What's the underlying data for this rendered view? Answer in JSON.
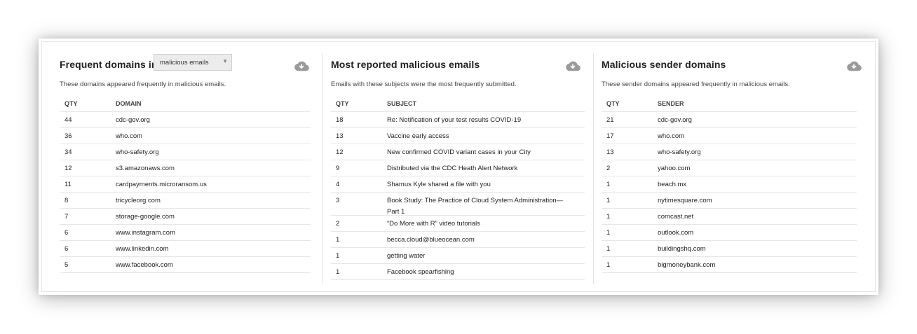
{
  "panels": [
    {
      "title": "Frequent domains in",
      "selector": {
        "value": "malicious emails"
      },
      "description": "These domains appeared frequently in malicious emails.",
      "icon": "cloud-download-icon",
      "columns": {
        "qty": "QTY",
        "value": "DOMAIN"
      },
      "rows": [
        {
          "qty": "44",
          "value": "cdc-gov.org"
        },
        {
          "qty": "36",
          "value": "who.com"
        },
        {
          "qty": "34",
          "value": "who-safety.org"
        },
        {
          "qty": "12",
          "value": "s3.amazonaws.com"
        },
        {
          "qty": "11",
          "value": "cardpayments.microransom.us"
        },
        {
          "qty": "8",
          "value": "tricycleorg.com"
        },
        {
          "qty": "7",
          "value": "storage-google.com"
        },
        {
          "qty": "6",
          "value": "www.instagram.com"
        },
        {
          "qty": "6",
          "value": "www.linkedin.com"
        },
        {
          "qty": "5",
          "value": "www.facebook.com"
        }
      ]
    },
    {
      "title": "Most reported malicious emails",
      "description": "Emails with these subjects were the most frequently submitted.",
      "icon": "cloud-download-icon",
      "columns": {
        "qty": "QTY",
        "value": "SUBJECT"
      },
      "rows": [
        {
          "qty": "18",
          "value": "Re: Notification of your test results COVID-19"
        },
        {
          "qty": "13",
          "value": "Vaccine early access"
        },
        {
          "qty": "12",
          "value": "New confirmed COVID variant cases in your City"
        },
        {
          "qty": "9",
          "value": "Distributed via the CDC Heath Alert Network"
        },
        {
          "qty": "4",
          "value": "Shamus Kyle shared a file with you"
        },
        {
          "qty": "3",
          "value": "Book Study: The Practice of Cloud System Administration— Part 1"
        },
        {
          "qty": "2",
          "value": "“Do More with R” video tutorials"
        },
        {
          "qty": "1",
          "value": "becca.cloud@blueocean.com"
        },
        {
          "qty": "1",
          "value": "getting water"
        },
        {
          "qty": "1",
          "value": "Facebook spearfishing"
        }
      ]
    },
    {
      "title": "Malicious sender domains",
      "description": "These sender domains appeared frequently in malicious emails.",
      "icon": "cloud-download-icon",
      "columns": {
        "qty": "QTY",
        "value": "SENDER"
      },
      "rows": [
        {
          "qty": "21",
          "value": "cdc-gov.org"
        },
        {
          "qty": "17",
          "value": "who.com"
        },
        {
          "qty": "13",
          "value": "who-safety.org"
        },
        {
          "qty": "2",
          "value": "yahoo.com"
        },
        {
          "qty": "1",
          "value": "beach.mx"
        },
        {
          "qty": "1",
          "value": "nytimesquare.com"
        },
        {
          "qty": "1",
          "value": "comcast.net"
        },
        {
          "qty": "1",
          "value": "outlook.com"
        },
        {
          "qty": "1",
          "value": "buildingshq.com"
        },
        {
          "qty": "1",
          "value": "bigmoneybank.com"
        }
      ]
    }
  ],
  "colors": {
    "icon": "#9a9a9a",
    "divider": "#e6e6e6",
    "text": "#222222"
  }
}
